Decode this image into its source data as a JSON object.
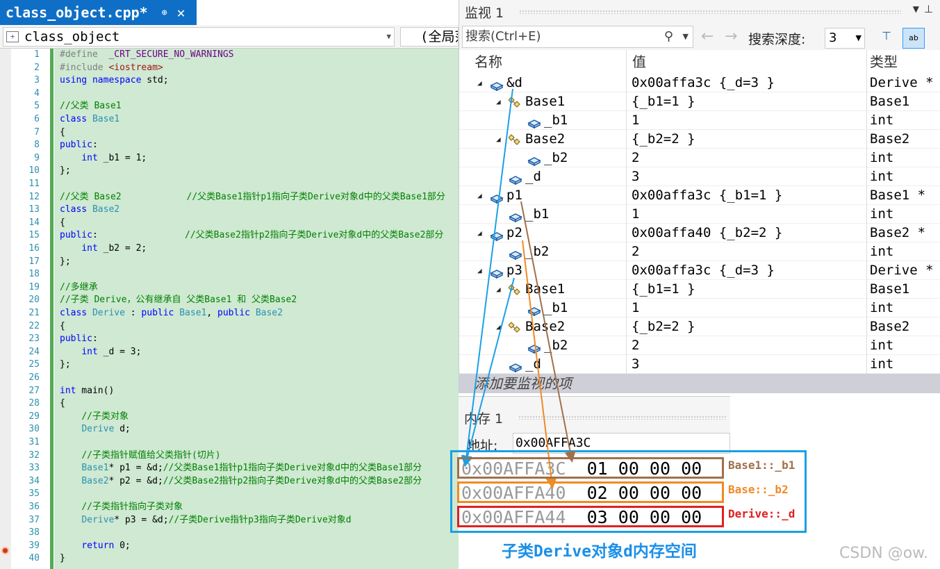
{
  "editor": {
    "tab_title": "class_object.cpp*",
    "tab_pin": "⊕",
    "tab_close": "✕",
    "scope_left": "class_object",
    "scope_right": "(全局范围)",
    "lines": [
      {
        "n": "1",
        "html": "<span class=\"pp\">#define  </span><span class=\"mac\">_CRT_SECURE_NO_WARNINGS</span>"
      },
      {
        "n": "2",
        "html": "<span class=\"pp\">#include </span><span class=\"st\">&lt;iostream&gt;</span>"
      },
      {
        "n": "3",
        "html": "<span class=\"kw\">using namespace</span> std;"
      },
      {
        "n": "4",
        "html": ""
      },
      {
        "n": "5",
        "html": "<span class=\"cm\">//父类 Base1</span>"
      },
      {
        "n": "6",
        "html": "<span class=\"kw\">class</span> <span class=\"ty\">Base1</span>"
      },
      {
        "n": "7",
        "html": "{"
      },
      {
        "n": "8",
        "html": "<span class=\"kw\">public</span>:"
      },
      {
        "n": "9",
        "html": "    <span class=\"kw\">int</span> _b1 = 1;"
      },
      {
        "n": "10",
        "html": "};"
      },
      {
        "n": "11",
        "html": ""
      },
      {
        "n": "12",
        "html": "<span class=\"cm\">//父类 Base2            //父类Base1指针p1指向子类Derive对象d中的父类Base1部分</span>"
      },
      {
        "n": "13",
        "html": "<span class=\"kw\">class</span> <span class=\"ty\">Base2</span>"
      },
      {
        "n": "14",
        "html": "{"
      },
      {
        "n": "15",
        "html": "<span class=\"kw\">public</span>:                <span class=\"cm\">//父类Base2指针p2指向子类Derive对象d中的父类Base2部分</span>"
      },
      {
        "n": "16",
        "html": "    <span class=\"kw\">int</span> _b2 = 2;"
      },
      {
        "n": "17",
        "html": "};"
      },
      {
        "n": "18",
        "html": ""
      },
      {
        "n": "19",
        "html": "<span class=\"cm\">//多继承</span>"
      },
      {
        "n": "20",
        "html": "<span class=\"cm\">//子类 Derive，公有继承自 父类Base1 和 父类Base2</span>"
      },
      {
        "n": "21",
        "html": "<span class=\"kw\">class</span> <span class=\"ty\">Derive</span> : <span class=\"kw\">public</span> <span class=\"ty\">Base1</span>, <span class=\"kw\">public</span> <span class=\"ty\">Base2</span>"
      },
      {
        "n": "22",
        "html": "{"
      },
      {
        "n": "23",
        "html": "<span class=\"kw\">public</span>:"
      },
      {
        "n": "24",
        "html": "    <span class=\"kw\">int</span> _d = 3;"
      },
      {
        "n": "25",
        "html": "};"
      },
      {
        "n": "26",
        "html": ""
      },
      {
        "n": "27",
        "html": "<span class=\"kw\">int</span> main()"
      },
      {
        "n": "28",
        "html": "{"
      },
      {
        "n": "29",
        "html": "    <span class=\"cm\">//子类对象</span>"
      },
      {
        "n": "30",
        "html": "    <span class=\"ty\">Derive</span> d;"
      },
      {
        "n": "31",
        "html": ""
      },
      {
        "n": "32",
        "html": "    <span class=\"cm\">//子类指针赋值给父类指针(切片)</span>"
      },
      {
        "n": "33",
        "html": "    <span class=\"ty\">Base1</span>* p1 = &amp;d;<span class=\"cm\">//父类Base1指针p1指向子类Derive对象d中的父类Base1部分</span>"
      },
      {
        "n": "34",
        "html": "    <span class=\"ty\">Base2</span>* p2 = &amp;d;<span class=\"cm\">//父类Base2指针p2指向子类Derive对象d中的父类Base2部分</span>"
      },
      {
        "n": "35",
        "html": ""
      },
      {
        "n": "36",
        "html": "    <span class=\"cm\">//子类指针指向子类对象</span>"
      },
      {
        "n": "37",
        "html": "    <span class=\"ty\">Derive</span>* p3 = &amp;d;<span class=\"cm\">//子类Derive指针p3指向子类Derive对象d</span>"
      },
      {
        "n": "38",
        "html": ""
      },
      {
        "n": "39",
        "html": "    <span class=\"kw\">return</span> 0;"
      },
      {
        "n": "40",
        "html": "}"
      }
    ]
  },
  "watch": {
    "title": "监视 1",
    "search_placeholder": "搜索(Ctrl+E)",
    "depth_label": "搜索深度:",
    "depth_value": "3",
    "col_name": "名称",
    "col_value": "值",
    "col_type": "类型",
    "rows": [
      {
        "name": "&d",
        "value": "0x00affa3c {_d=3 }",
        "type": "Derive *",
        "depth": 0,
        "expander": "◢",
        "icon": "var"
      },
      {
        "name": "Base1",
        "value": "{_b1=1 }",
        "type": "Base1",
        "depth": 1,
        "expander": "◢",
        "icon": "base"
      },
      {
        "name": "_b1",
        "value": "1",
        "type": "int",
        "depth": 2,
        "expander": "",
        "icon": "var"
      },
      {
        "name": "Base2",
        "value": "{_b2=2 }",
        "type": "Base2",
        "depth": 1,
        "expander": "◢",
        "icon": "base"
      },
      {
        "name": "_b2",
        "value": "2",
        "type": "int",
        "depth": 2,
        "expander": "",
        "icon": "var"
      },
      {
        "name": "_d",
        "value": "3",
        "type": "int",
        "depth": 1,
        "expander": "",
        "icon": "var"
      },
      {
        "name": "p1",
        "value": "0x00affa3c {_b1=1 }",
        "type": "Base1 *",
        "depth": 0,
        "expander": "◢",
        "icon": "var"
      },
      {
        "name": "_b1",
        "value": "1",
        "type": "int",
        "depth": 1,
        "expander": "",
        "icon": "var"
      },
      {
        "name": "p2",
        "value": "0x00affa40 {_b2=2 }",
        "type": "Base2 *",
        "depth": 0,
        "expander": "◢",
        "icon": "var"
      },
      {
        "name": "_b2",
        "value": "2",
        "type": "int",
        "depth": 1,
        "expander": "",
        "icon": "var"
      },
      {
        "name": "p3",
        "value": "0x00affa3c {_d=3 }",
        "type": "Derive *",
        "depth": 0,
        "expander": "◢",
        "icon": "var"
      },
      {
        "name": "Base1",
        "value": "{_b1=1 }",
        "type": "Base1",
        "depth": 1,
        "expander": "◢",
        "icon": "base"
      },
      {
        "name": "_b1",
        "value": "1",
        "type": "int",
        "depth": 2,
        "expander": "",
        "icon": "var"
      },
      {
        "name": "Base2",
        "value": "{_b2=2 }",
        "type": "Base2",
        "depth": 1,
        "expander": "◢",
        "icon": "base"
      },
      {
        "name": "_b2",
        "value": "2",
        "type": "int",
        "depth": 2,
        "expander": "",
        "icon": "var"
      },
      {
        "name": "_d",
        "value": "3",
        "type": "int",
        "depth": 1,
        "expander": "",
        "icon": "var"
      }
    ],
    "add_item": "添加要监视的项"
  },
  "memory": {
    "title": "内存 1",
    "address_label": "地址:",
    "address_value": "0x00AFFA3C",
    "rows": [
      {
        "addr": "0x00AFFA3C",
        "bytes": "01 00 00 00",
        "label": "Base1::_b1"
      },
      {
        "addr": "0x00AFFA40",
        "bytes": "02 00 00 00",
        "label": "Base::_b2"
      },
      {
        "addr": "0x00AFFA44",
        "bytes": "03 00 00 00",
        "label": "Derive::_d"
      }
    ],
    "caption": "子类Derive对象d内存空间"
  },
  "colors": {
    "blue_box": "#1aa0e6",
    "brown": "#a0704a",
    "orange": "#f08a24",
    "red": "#e02020",
    "tab": "#0f6fc6"
  },
  "watermark": "CSDN @ow."
}
